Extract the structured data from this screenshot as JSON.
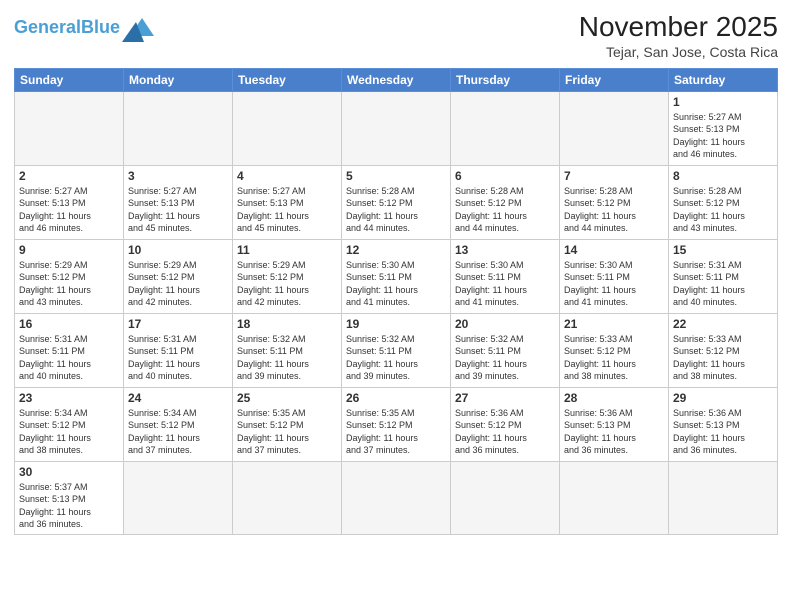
{
  "header": {
    "logo_general": "General",
    "logo_blue": "Blue",
    "month_title": "November 2025",
    "location": "Tejar, San Jose, Costa Rica"
  },
  "weekdays": [
    "Sunday",
    "Monday",
    "Tuesday",
    "Wednesday",
    "Thursday",
    "Friday",
    "Saturday"
  ],
  "weeks": [
    [
      {
        "day": "",
        "info": ""
      },
      {
        "day": "",
        "info": ""
      },
      {
        "day": "",
        "info": ""
      },
      {
        "day": "",
        "info": ""
      },
      {
        "day": "",
        "info": ""
      },
      {
        "day": "",
        "info": ""
      },
      {
        "day": "1",
        "info": "Sunrise: 5:27 AM\nSunset: 5:13 PM\nDaylight: 11 hours\nand 46 minutes."
      }
    ],
    [
      {
        "day": "2",
        "info": "Sunrise: 5:27 AM\nSunset: 5:13 PM\nDaylight: 11 hours\nand 46 minutes."
      },
      {
        "day": "3",
        "info": "Sunrise: 5:27 AM\nSunset: 5:13 PM\nDaylight: 11 hours\nand 45 minutes."
      },
      {
        "day": "4",
        "info": "Sunrise: 5:27 AM\nSunset: 5:13 PM\nDaylight: 11 hours\nand 45 minutes."
      },
      {
        "day": "5",
        "info": "Sunrise: 5:28 AM\nSunset: 5:12 PM\nDaylight: 11 hours\nand 44 minutes."
      },
      {
        "day": "6",
        "info": "Sunrise: 5:28 AM\nSunset: 5:12 PM\nDaylight: 11 hours\nand 44 minutes."
      },
      {
        "day": "7",
        "info": "Sunrise: 5:28 AM\nSunset: 5:12 PM\nDaylight: 11 hours\nand 44 minutes."
      },
      {
        "day": "8",
        "info": "Sunrise: 5:28 AM\nSunset: 5:12 PM\nDaylight: 11 hours\nand 43 minutes."
      }
    ],
    [
      {
        "day": "9",
        "info": "Sunrise: 5:29 AM\nSunset: 5:12 PM\nDaylight: 11 hours\nand 43 minutes."
      },
      {
        "day": "10",
        "info": "Sunrise: 5:29 AM\nSunset: 5:12 PM\nDaylight: 11 hours\nand 42 minutes."
      },
      {
        "day": "11",
        "info": "Sunrise: 5:29 AM\nSunset: 5:12 PM\nDaylight: 11 hours\nand 42 minutes."
      },
      {
        "day": "12",
        "info": "Sunrise: 5:30 AM\nSunset: 5:11 PM\nDaylight: 11 hours\nand 41 minutes."
      },
      {
        "day": "13",
        "info": "Sunrise: 5:30 AM\nSunset: 5:11 PM\nDaylight: 11 hours\nand 41 minutes."
      },
      {
        "day": "14",
        "info": "Sunrise: 5:30 AM\nSunset: 5:11 PM\nDaylight: 11 hours\nand 41 minutes."
      },
      {
        "day": "15",
        "info": "Sunrise: 5:31 AM\nSunset: 5:11 PM\nDaylight: 11 hours\nand 40 minutes."
      }
    ],
    [
      {
        "day": "16",
        "info": "Sunrise: 5:31 AM\nSunset: 5:11 PM\nDaylight: 11 hours\nand 40 minutes."
      },
      {
        "day": "17",
        "info": "Sunrise: 5:31 AM\nSunset: 5:11 PM\nDaylight: 11 hours\nand 40 minutes."
      },
      {
        "day": "18",
        "info": "Sunrise: 5:32 AM\nSunset: 5:11 PM\nDaylight: 11 hours\nand 39 minutes."
      },
      {
        "day": "19",
        "info": "Sunrise: 5:32 AM\nSunset: 5:11 PM\nDaylight: 11 hours\nand 39 minutes."
      },
      {
        "day": "20",
        "info": "Sunrise: 5:32 AM\nSunset: 5:11 PM\nDaylight: 11 hours\nand 39 minutes."
      },
      {
        "day": "21",
        "info": "Sunrise: 5:33 AM\nSunset: 5:12 PM\nDaylight: 11 hours\nand 38 minutes."
      },
      {
        "day": "22",
        "info": "Sunrise: 5:33 AM\nSunset: 5:12 PM\nDaylight: 11 hours\nand 38 minutes."
      }
    ],
    [
      {
        "day": "23",
        "info": "Sunrise: 5:34 AM\nSunset: 5:12 PM\nDaylight: 11 hours\nand 38 minutes."
      },
      {
        "day": "24",
        "info": "Sunrise: 5:34 AM\nSunset: 5:12 PM\nDaylight: 11 hours\nand 37 minutes."
      },
      {
        "day": "25",
        "info": "Sunrise: 5:35 AM\nSunset: 5:12 PM\nDaylight: 11 hours\nand 37 minutes."
      },
      {
        "day": "26",
        "info": "Sunrise: 5:35 AM\nSunset: 5:12 PM\nDaylight: 11 hours\nand 37 minutes."
      },
      {
        "day": "27",
        "info": "Sunrise: 5:36 AM\nSunset: 5:12 PM\nDaylight: 11 hours\nand 36 minutes."
      },
      {
        "day": "28",
        "info": "Sunrise: 5:36 AM\nSunset: 5:13 PM\nDaylight: 11 hours\nand 36 minutes."
      },
      {
        "day": "29",
        "info": "Sunrise: 5:36 AM\nSunset: 5:13 PM\nDaylight: 11 hours\nand 36 minutes."
      }
    ],
    [
      {
        "day": "30",
        "info": "Sunrise: 5:37 AM\nSunset: 5:13 PM\nDaylight: 11 hours\nand 36 minutes."
      },
      {
        "day": "",
        "info": ""
      },
      {
        "day": "",
        "info": ""
      },
      {
        "day": "",
        "info": ""
      },
      {
        "day": "",
        "info": ""
      },
      {
        "day": "",
        "info": ""
      },
      {
        "day": "",
        "info": ""
      }
    ]
  ]
}
